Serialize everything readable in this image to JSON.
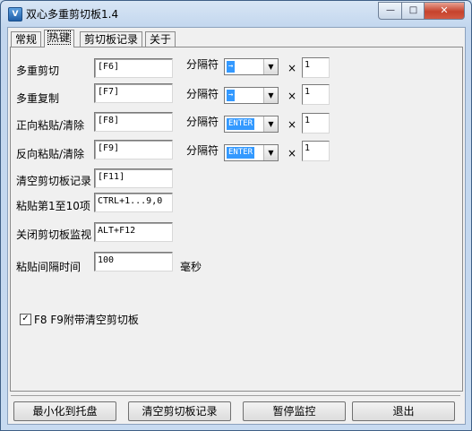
{
  "window": {
    "title": "双心多重剪切板1.4",
    "icon_letter": "V",
    "minimize_glyph": "—",
    "maximize_glyph": "□",
    "close_glyph": "✕"
  },
  "tabs": [
    {
      "label": "常规"
    },
    {
      "label": "热键"
    },
    {
      "label": "剪切板记录"
    },
    {
      "label": "关于"
    }
  ],
  "active_tab": "热键",
  "hotkeys": [
    {
      "label": "多重剪切",
      "value": "[F6]",
      "separator_label": "分隔符",
      "separator_value": "→",
      "times": "×",
      "count": "1"
    },
    {
      "label": "多重复制",
      "value": "[F7]",
      "separator_label": "分隔符",
      "separator_value": "→",
      "times": "×",
      "count": "1"
    },
    {
      "label": "正向粘贴/清除",
      "value": "[F8]",
      "separator_label": "分隔符",
      "separator_value": "ENTER",
      "times": "×",
      "count": "1"
    },
    {
      "label": "反向粘贴/清除",
      "value": "[F9]",
      "separator_label": "分隔符",
      "separator_value": "ENTER",
      "times": "×",
      "count": "1"
    },
    {
      "label": "清空剪切板记录",
      "value": "[F11]"
    },
    {
      "label": "粘贴第1至10项",
      "value": "CTRL+1...9,0"
    },
    {
      "label": "关闭剪切板监视",
      "value": "ALT+F12"
    }
  ],
  "interval": {
    "label": "粘贴间隔时间",
    "value": "100",
    "unit": "毫秒"
  },
  "checkbox": {
    "label": "F8 F9附带清空剪切板",
    "checked": true,
    "mark": "✓"
  },
  "combo_arrow": "▼",
  "buttons": [
    {
      "label": "最小化到托盘"
    },
    {
      "label": "清空剪切板记录"
    },
    {
      "label": "暂停监控"
    },
    {
      "label": "退出"
    }
  ],
  "colors": {
    "selection": "#3399ff",
    "panel": "#f0f0f0",
    "frame": "#c7daf0"
  }
}
